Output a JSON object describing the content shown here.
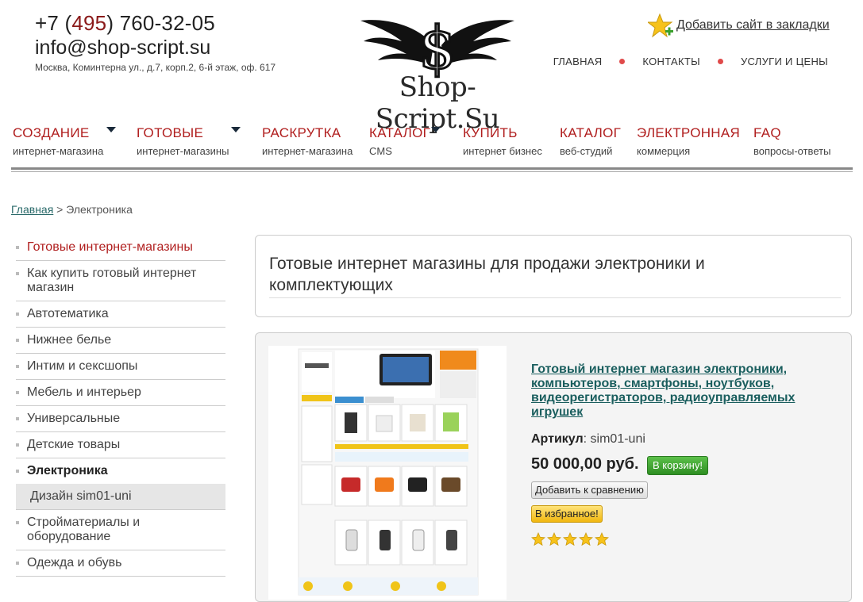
{
  "header": {
    "phone_prefix": "+7 (",
    "phone_code": "495",
    "phone_rest": ") 760-32-05",
    "email": "info@shop-script.su",
    "address": "Москва, Коминтерна ул., д.7, корп.2, 6-й этаж, оф. 617",
    "logo_text": "Shop-Script.Su",
    "bookmark_label": "Добавить сайт в закладки",
    "topnav": [
      "ГЛАВНАЯ",
      "КОНТАКТЫ",
      "УСЛУГИ И ЦЕНЫ"
    ]
  },
  "mainmenu": [
    {
      "title": "СОЗДАНИЕ",
      "sub": "интернет-магазина",
      "dropdown": true
    },
    {
      "title": "ГОТОВЫЕ",
      "sub": "интернет-магазины",
      "dropdown": true
    },
    {
      "title": "РАСКРУТКА",
      "sub": "интернет-магазина",
      "dropdown": false
    },
    {
      "title": "КАТАЛОГ",
      "sub": "CMS",
      "dropdown": true
    },
    {
      "title": "КУПИТЬ",
      "sub": "интернет бизнес",
      "dropdown": false
    },
    {
      "title": "КАТАЛОГ",
      "sub": "веб-студий",
      "dropdown": false
    },
    {
      "title": "ЭЛЕКТРОННАЯ",
      "sub": "коммерция",
      "dropdown": false
    },
    {
      "title": "FAQ",
      "sub": "вопросы-ответы",
      "dropdown": false
    }
  ],
  "breadcrumb": {
    "home": "Главная",
    "sep": " > ",
    "current": "Электроника"
  },
  "sidebar": {
    "items": [
      "Готовые интернет-магазины",
      "Как купить готовый интернет магазин",
      "Автотематика",
      "Нижнее белье",
      "Интим и сексшопы",
      "Мебель и интерьер",
      "Универсальные",
      "Детские товары",
      "Электроника",
      "Дизайн sim01-uni",
      "Стройматериалы и оборудование",
      "Одежда и обувь"
    ]
  },
  "page": {
    "title": "Готовые интернет магазины для продажи электроники и комплектующих"
  },
  "product": {
    "title": "Готовый интернет магазин электроники, компьютеров, смартфоны, ноутбуков, видеорегистраторов, радиоуправляемых игрушек",
    "sku_label": "Артикул",
    "sku_value": ": sim01-uni",
    "price": "50 000,00 руб.",
    "cart_label": "В корзину!",
    "compare_label": "Добавить к сравнению",
    "fav_label": "В избранное!",
    "rating": 5
  },
  "colors": {
    "accent": "#b01e1e",
    "link": "#1a5e5e",
    "cart": "#3aa02c",
    "fav": "#f1b70f"
  }
}
